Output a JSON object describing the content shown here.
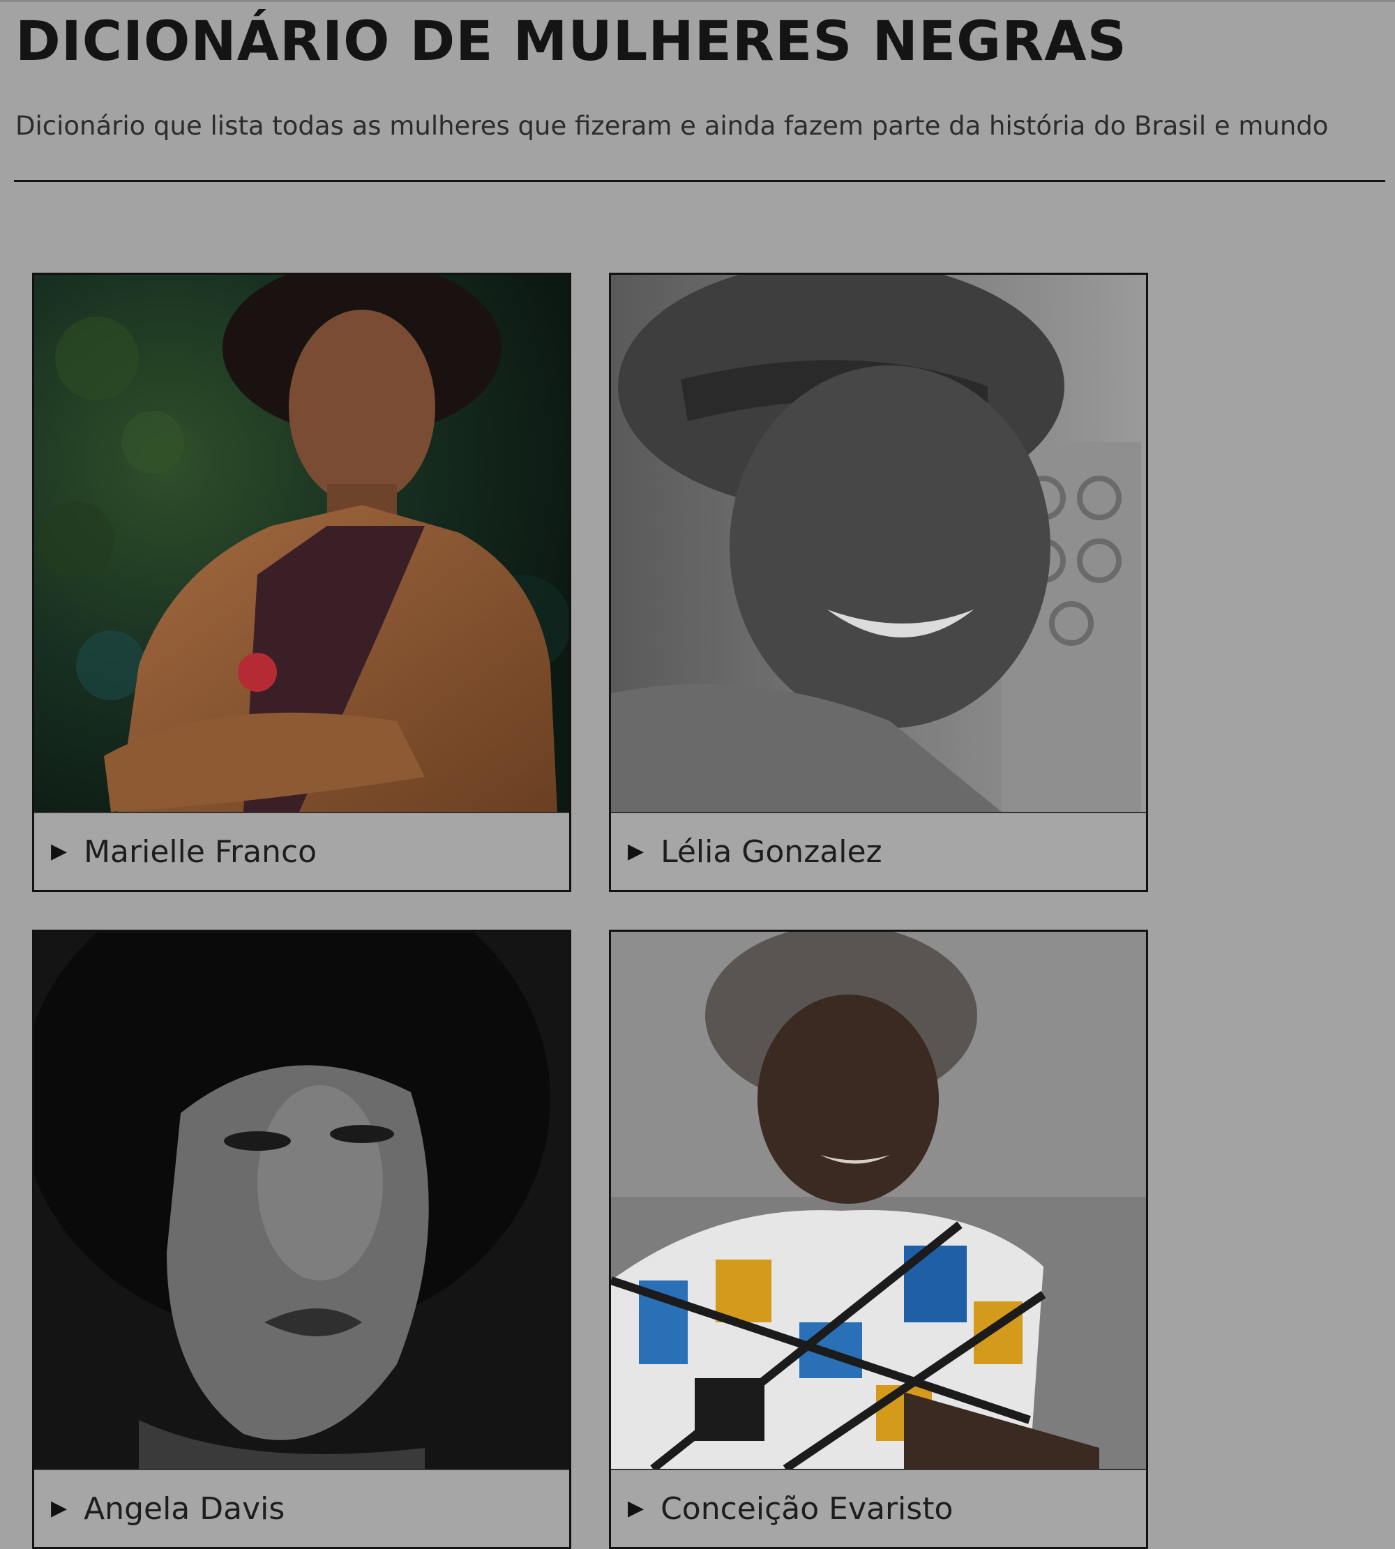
{
  "header": {
    "title": "DICIONÁRIO DE MULHERES NEGRAS",
    "subtitle": "Dicionário que lista todas as mulheres que fizeram e ainda fazem parte da história do Brasil e mundo"
  },
  "cards": [
    {
      "name": "Marielle Franco",
      "arrow": "▶"
    },
    {
      "name": "Lélia Gonzalez",
      "arrow": "▶"
    },
    {
      "name": "Angela Davis",
      "arrow": "▶"
    },
    {
      "name": "Conceição Evaristo",
      "arrow": "▶"
    }
  ],
  "colors": {
    "page_background": "#a3a3a3",
    "text": "#141414",
    "rule": "#151515"
  }
}
